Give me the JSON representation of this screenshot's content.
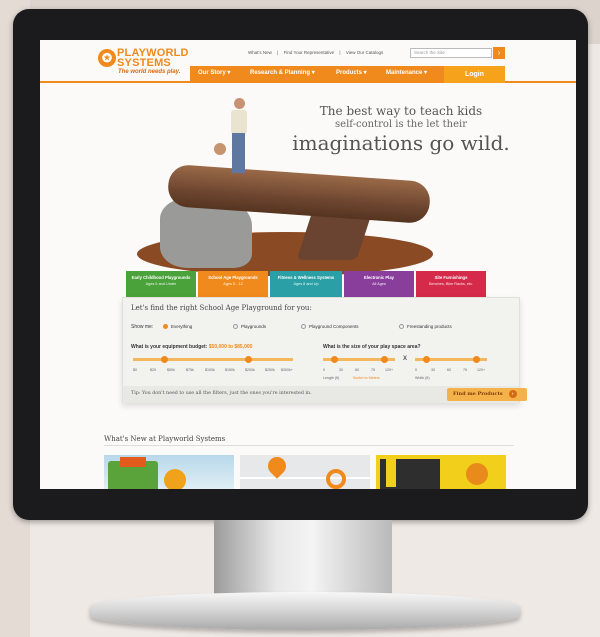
{
  "brand": {
    "name_line1": "PLAYWORLD",
    "name_line2": "SYSTEMS",
    "tagline": "The world needs play.",
    "accent": "#f08a1c"
  },
  "utility_links": [
    "What's New",
    "|",
    "Find Your Representative",
    "|",
    "View Our Catalogs"
  ],
  "search": {
    "placeholder": "Search the Site",
    "go_label": "›"
  },
  "nav": {
    "items": [
      "Our Story",
      "Research & Planning",
      "Products",
      "Maintenance"
    ],
    "login_label": "Login"
  },
  "hero": {
    "line1": "The best way to teach kids",
    "line2": "self-control is the let their",
    "line3": "imaginations go wild."
  },
  "tabs": [
    {
      "label": "Early Childhood Playgrounds",
      "sub": "Ages 6 and Under",
      "color": "#4aa23a"
    },
    {
      "label": "School Age Playgrounds",
      "sub": "Ages 5 - 12",
      "color": "#f08a1c"
    },
    {
      "label": "Fitness & Wellness Systems",
      "sub": "Ages 8 and Up",
      "color": "#2aa0a6"
    },
    {
      "label": "Electronic Play",
      "sub": "All Ages",
      "color": "#8a3e9c"
    },
    {
      "label": "Site Furnishings",
      "sub": "Benches, Bike Racks, etc.",
      "color": "#d52a4a"
    }
  ],
  "finder": {
    "title": "Let's find the right School Age Playground for you:",
    "show_me_label": "Show me:",
    "options": [
      "Everything",
      "Playgrounds",
      "Playground Components",
      "Freestanding products"
    ],
    "selected_option": "Everything",
    "budget_question": "What is your equipment budget:",
    "budget_value": "$50,000 to $85,000",
    "budget_ticks": [
      "$0",
      "$25",
      "$50k",
      "$75k",
      "$100k",
      "$150k",
      "$200k",
      "$250k",
      "$300k+"
    ],
    "space_question": "What is the size of your play space area?",
    "length_ticks": [
      "0",
      "30",
      "60",
      "75",
      "120+"
    ],
    "width_ticks": [
      "0",
      "30",
      "60",
      "75",
      "120+"
    ],
    "length_label": "Length (ft)",
    "switch_label": "Switch to Meters",
    "width_label": "Width (ft)",
    "separator": "X",
    "tip": "Tip: You don't need to use all the filters, just the ones you're interested in.",
    "find_button": "Find me Products"
  },
  "whats_new": {
    "title": "What's New at Playworld Systems"
  }
}
